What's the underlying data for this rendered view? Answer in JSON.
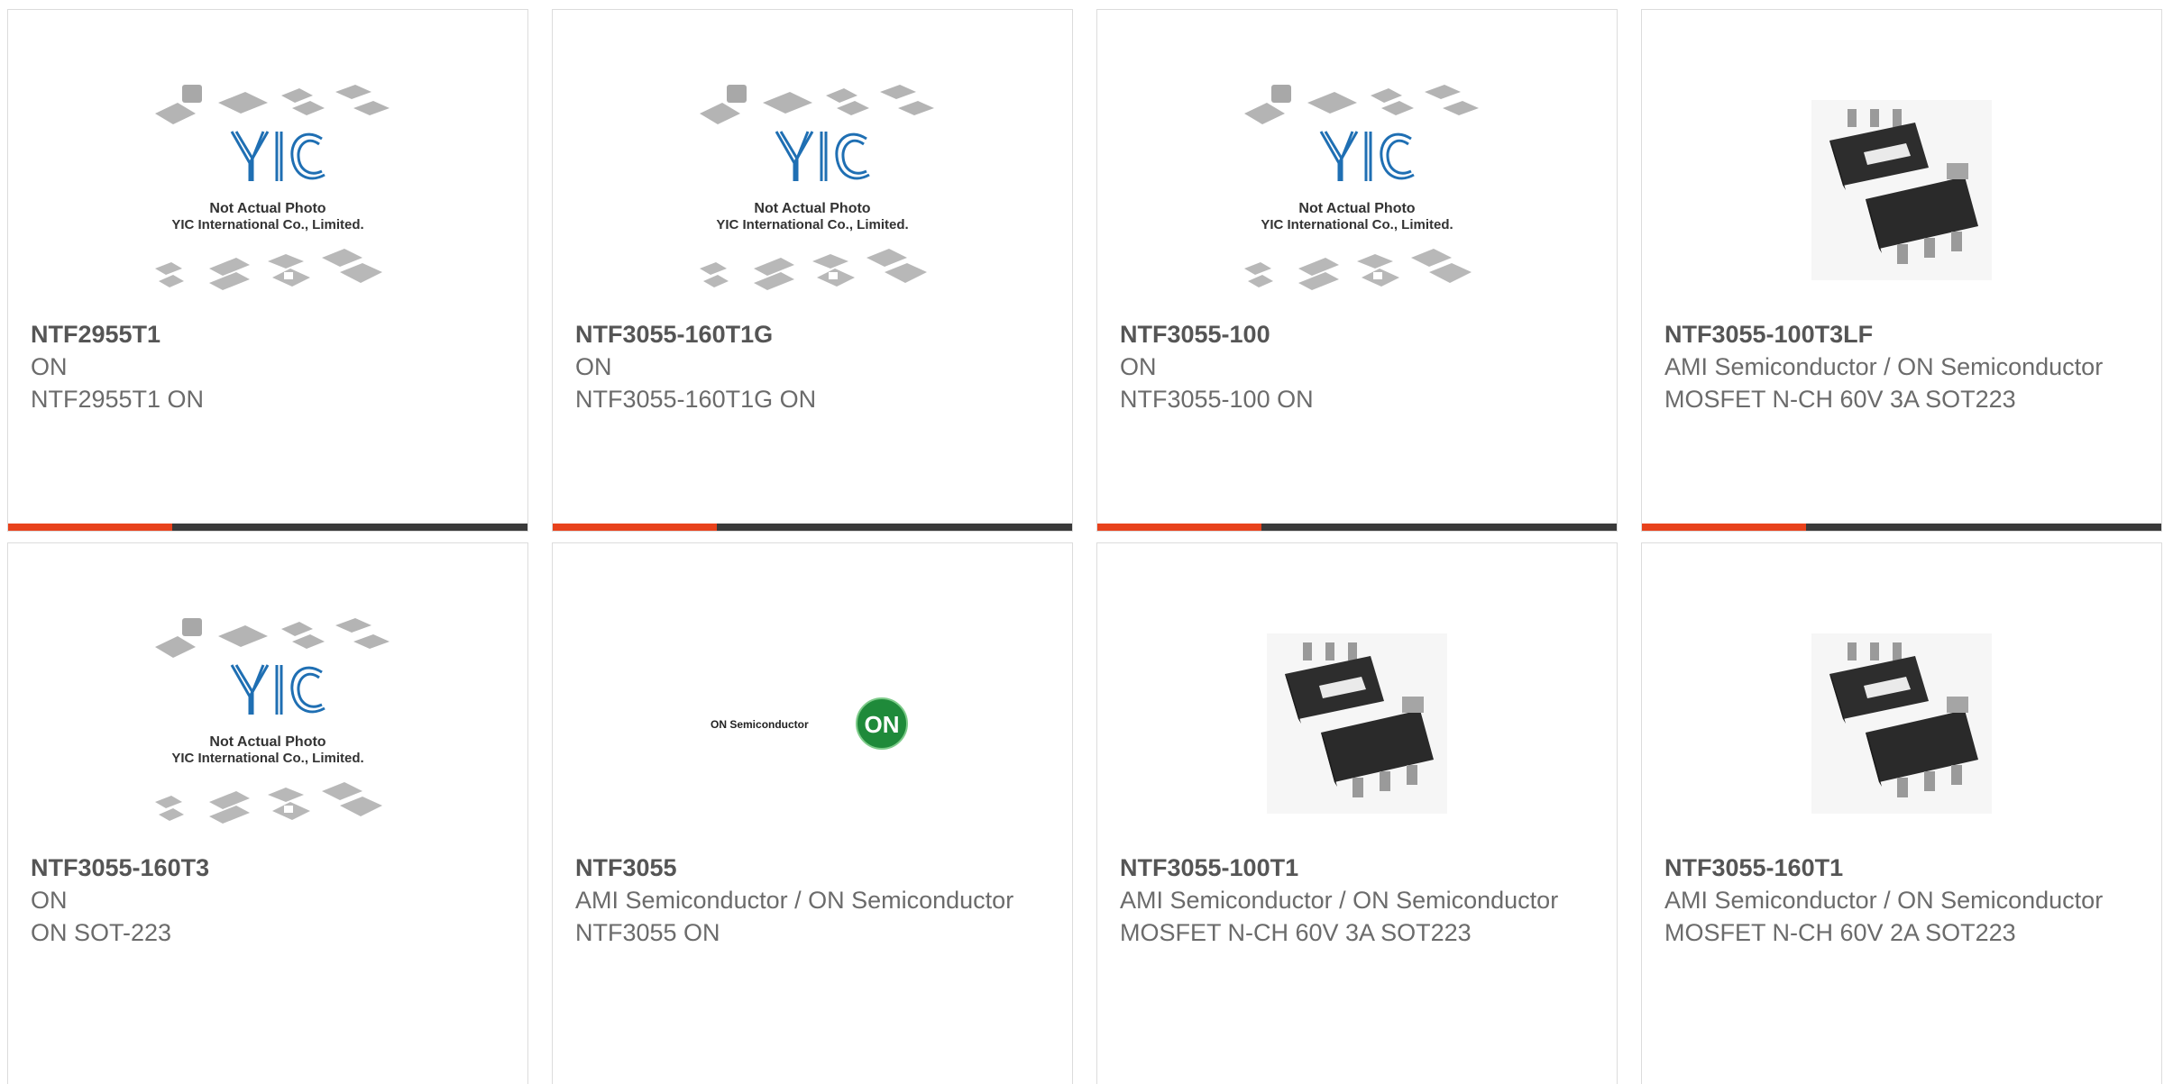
{
  "products": [
    {
      "pn": "NTF2955T1",
      "mfr": "ON",
      "desc": "NTF2955T1 ON",
      "image": "yic-placeholder",
      "image_text": {
        "line1": "Not Actual Photo",
        "line2": "YIC International Co., Limited.",
        "logo": "YIC"
      }
    },
    {
      "pn": "NTF3055-160T1G",
      "mfr": "ON",
      "desc": "NTF3055-160T1G ON",
      "image": "yic-placeholder",
      "image_text": {
        "line1": "Not Actual Photo",
        "line2": "YIC International Co., Limited.",
        "logo": "YIC"
      }
    },
    {
      "pn": "NTF3055-100",
      "mfr": "ON",
      "desc": "NTF3055-100 ON",
      "image": "yic-placeholder",
      "image_text": {
        "line1": "Not Actual Photo",
        "line2": "YIC International Co., Limited.",
        "logo": "YIC"
      }
    },
    {
      "pn": "NTF3055-100T3LF",
      "mfr": "AMI Semiconductor / ON Semiconductor",
      "desc": "MOSFET N-CH 60V 3A SOT223",
      "image": "sot223-chip"
    },
    {
      "pn": "NTF3055-160T3",
      "mfr": "ON",
      "desc": "ON SOT-223",
      "image": "yic-placeholder",
      "image_text": {
        "line1": "Not Actual Photo",
        "line2": "YIC International Co., Limited.",
        "logo": "YIC"
      }
    },
    {
      "pn": "NTF3055",
      "mfr": "AMI Semiconductor / ON Semiconductor",
      "desc": "NTF3055 ON",
      "image": "on-semi-logo",
      "image_text": {
        "brand": "ON Semiconductor",
        "badge": "ON"
      }
    },
    {
      "pn": "NTF3055-100T1",
      "mfr": "AMI Semiconductor / ON Semiconductor",
      "desc": "MOSFET N-CH 60V 3A SOT223",
      "image": "sot223-chip"
    },
    {
      "pn": "NTF3055-160T1",
      "mfr": "AMI Semiconductor / ON Semiconductor",
      "desc": "MOSFET N-CH 60V 2A SOT223",
      "image": "sot223-chip"
    }
  ],
  "colors": {
    "accent": "#e8421c",
    "bar": "#3a3a3a",
    "text": "#6b6b6b",
    "yic_blue": "#1f6fb3",
    "on_green": "#1f8a3a"
  }
}
